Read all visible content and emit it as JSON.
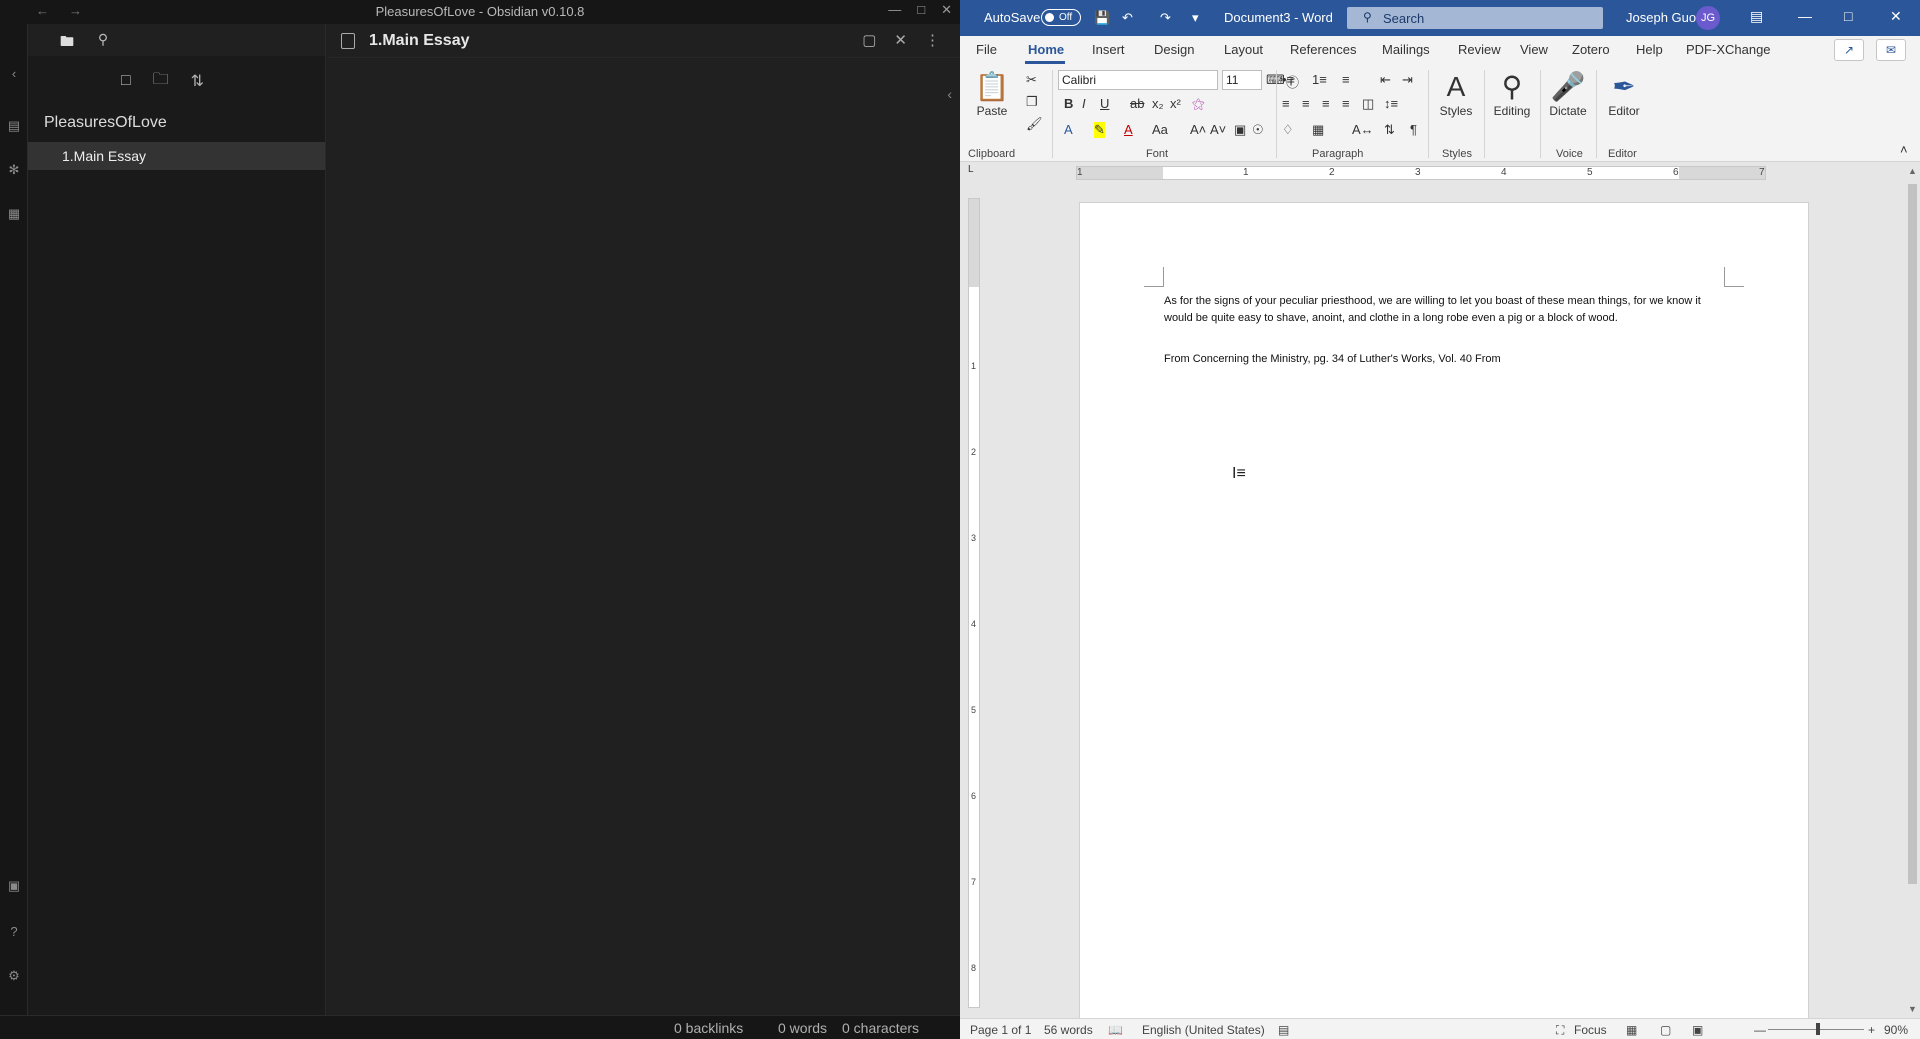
{
  "obsidian": {
    "window_title": "PleasuresOfLove - Obsidian v0.10.8",
    "vault_name": "PleasuresOfLove",
    "files": [
      "1.Main Essay"
    ],
    "active_tab_title": "1.Main Essay",
    "status": {
      "backlinks": "0 backlinks",
      "words": "0 words",
      "characters": "0 characters"
    }
  },
  "word": {
    "autosave_label": "AutoSave",
    "autosave_state": "Off",
    "doc_title": "Document3 - Word",
    "search_placeholder": "Search",
    "user_name": "Joseph Guo",
    "user_initials": "JG",
    "tabs": [
      "File",
      "Home",
      "Insert",
      "Design",
      "Layout",
      "References",
      "Mailings",
      "Review",
      "View",
      "Zotero",
      "Help",
      "PDF-XChange"
    ],
    "active_tab": "Home",
    "ribbon": {
      "paste_label": "Paste",
      "font_name": "Calibri",
      "font_size": "11",
      "styles_label": "Styles",
      "editing_label": "Editing",
      "dictate_label": "Dictate",
      "editor_label": "Editor",
      "groups": {
        "clipboard": "Clipboard",
        "font": "Font",
        "paragraph": "Paragraph",
        "styles": "Styles",
        "voice": "Voice",
        "editor": "Editor"
      }
    },
    "ruler_h_numbers": [
      "1",
      "1",
      "2",
      "3",
      "4",
      "5",
      "6",
      "7"
    ],
    "ruler_v_numbers": [
      "1",
      "2",
      "3",
      "4",
      "5",
      "6",
      "7",
      "8"
    ],
    "document": {
      "paragraph1": "As for the signs of your peculiar priesthood, we are willing to let you boast of these mean things, for we know it would be quite easy to shave, anoint, and clothe in a long robe even a pig or a block of wood.",
      "paragraph2": "From Concerning the Ministry, pg. 34 of Luther's Works, Vol. 40 From"
    },
    "status": {
      "page": "Page 1 of 1",
      "words": "56 words",
      "language": "English (United States)",
      "focus": "Focus",
      "zoom": "90%"
    },
    "accent_color": "#2b579a"
  }
}
